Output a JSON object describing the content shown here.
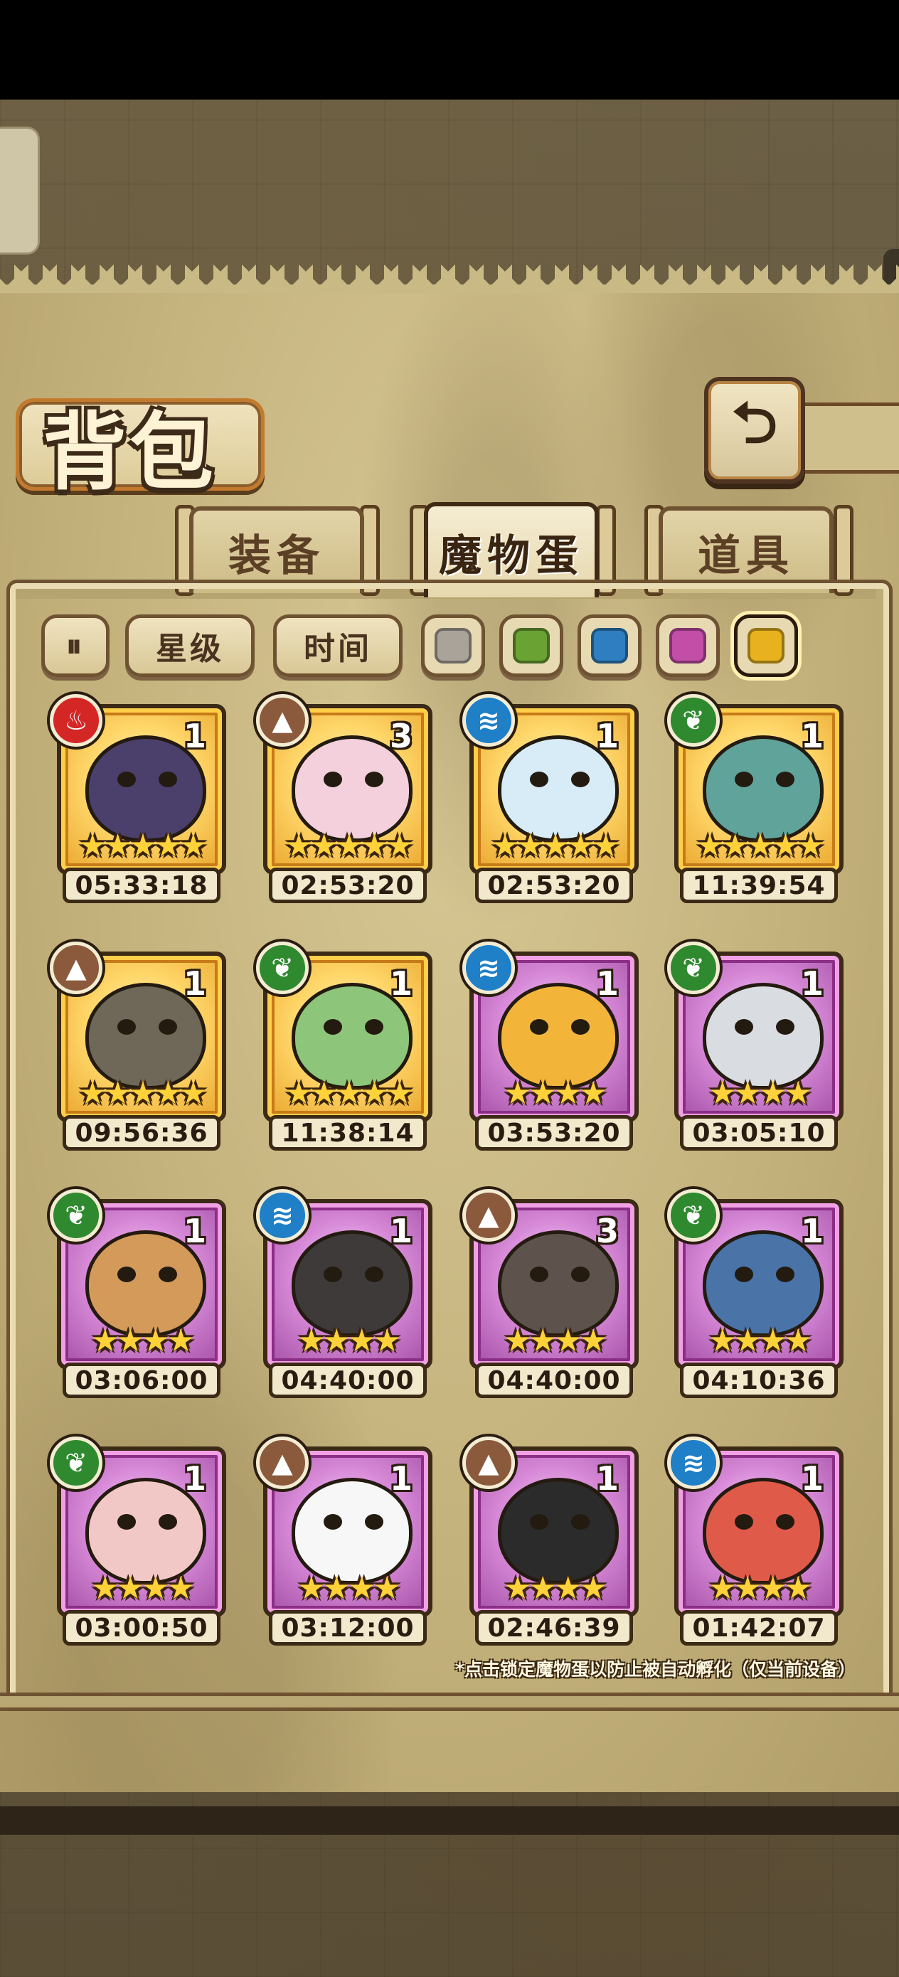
{
  "screen": {
    "title": "背包",
    "back_icon": "return-arrow-icon",
    "tabs": [
      {
        "label": "装备",
        "active": false
      },
      {
        "label": "魔物蛋",
        "active": true
      },
      {
        "label": "道具",
        "active": false
      }
    ],
    "filters": {
      "sort_toggle_icon": "sort-toggle-icon",
      "sort_stars_label": "星级",
      "sort_time_label": "时间",
      "rarity_swatches": [
        {
          "name": "gray",
          "color": "#a9a39a"
        },
        {
          "name": "green",
          "color": "#6aa234"
        },
        {
          "name": "blue",
          "color": "#2f7fc0"
        },
        {
          "name": "purple",
          "color": "#c24ea8"
        },
        {
          "name": "gold",
          "color": "#e7b21e",
          "selected": true
        }
      ]
    },
    "eggs": [
      {
        "element": "fire",
        "rarity": "gold",
        "count": "1",
        "stars": 5,
        "timer": "05:33:18",
        "color": "#4b3f6b"
      },
      {
        "element": "earth",
        "rarity": "gold",
        "count": "3",
        "stars": 5,
        "timer": "02:53:20",
        "color": "#f3d0dc"
      },
      {
        "element": "water",
        "rarity": "gold",
        "count": "1",
        "stars": 5,
        "timer": "02:53:20",
        "color": "#d7ecf7"
      },
      {
        "element": "grass",
        "rarity": "gold",
        "count": "1",
        "stars": 5,
        "timer": "11:39:54",
        "color": "#5fa39a"
      },
      {
        "element": "earth",
        "rarity": "gold",
        "count": "1",
        "stars": 5,
        "timer": "09:56:36",
        "color": "#6f6858"
      },
      {
        "element": "grass",
        "rarity": "gold",
        "count": "1",
        "stars": 5,
        "timer": "11:38:14",
        "color": "#8dc67a"
      },
      {
        "element": "water",
        "rarity": "purple",
        "count": "1",
        "stars": 4,
        "timer": "03:53:20",
        "color": "#f2b53a"
      },
      {
        "element": "grass",
        "rarity": "purple",
        "count": "1",
        "stars": 4,
        "timer": "03:05:10",
        "color": "#d9dde2"
      },
      {
        "element": "grass",
        "rarity": "purple",
        "count": "1",
        "stars": 4,
        "timer": "03:06:00",
        "color": "#d39a5a"
      },
      {
        "element": "water",
        "rarity": "purple",
        "count": "1",
        "stars": 4,
        "timer": "04:40:00",
        "color": "#3e3a3a"
      },
      {
        "element": "earth",
        "rarity": "purple",
        "count": "3",
        "stars": 4,
        "timer": "04:40:00",
        "color": "#5e524d"
      },
      {
        "element": "grass",
        "rarity": "purple",
        "count": "1",
        "stars": 4,
        "timer": "04:10:36",
        "color": "#4a73a8"
      },
      {
        "element": "grass",
        "rarity": "purple",
        "count": "1",
        "stars": 4,
        "timer": "03:00:50",
        "color": "#f2c8c6"
      },
      {
        "element": "earth",
        "rarity": "purple",
        "count": "1",
        "stars": 4,
        "timer": "03:12:00",
        "color": "#f7f7f7"
      },
      {
        "element": "earth",
        "rarity": "purple",
        "count": "1",
        "stars": 4,
        "timer": "02:46:39",
        "color": "#2b2b2b"
      },
      {
        "element": "water",
        "rarity": "purple",
        "count": "1",
        "stars": 4,
        "timer": "01:42:07",
        "color": "#e05a4a"
      }
    ],
    "note": "*点击锁定魔物蛋以防止被自动孵化（仅当前设备）"
  }
}
